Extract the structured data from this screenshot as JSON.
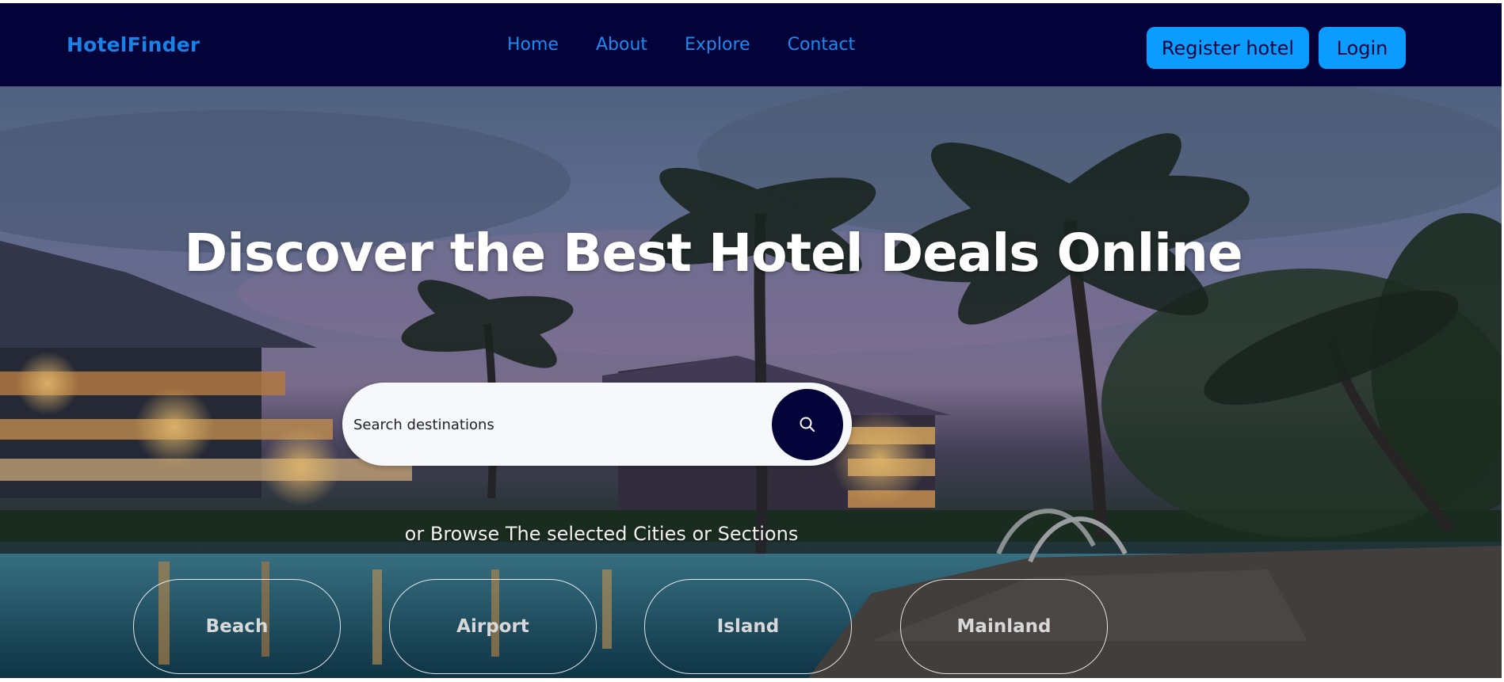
{
  "app": {
    "brand": "HotelFinder"
  },
  "nav": {
    "links": [
      {
        "label": "Home"
      },
      {
        "label": "About"
      },
      {
        "label": "Explore"
      },
      {
        "label": "Contact"
      }
    ],
    "register_label": "Register hotel",
    "login_label": "Login"
  },
  "hero": {
    "title": "Discover the Best Hotel Deals Online",
    "search": {
      "placeholder": "Search destinations",
      "button_icon": "search-icon"
    },
    "browse_text": "or Browse The selected Cities or Sections",
    "categories": [
      {
        "label": "Beach"
      },
      {
        "label": "Airport"
      },
      {
        "label": "Island"
      },
      {
        "label": "Mainland"
      }
    ]
  },
  "colors": {
    "navbar_bg": "#03033a",
    "brand": "#1a82e6",
    "nav_link": "#1a8bf0",
    "button_bg": "#0a9cff",
    "button_text": "#02063a",
    "search_button_bg": "#03033a"
  }
}
